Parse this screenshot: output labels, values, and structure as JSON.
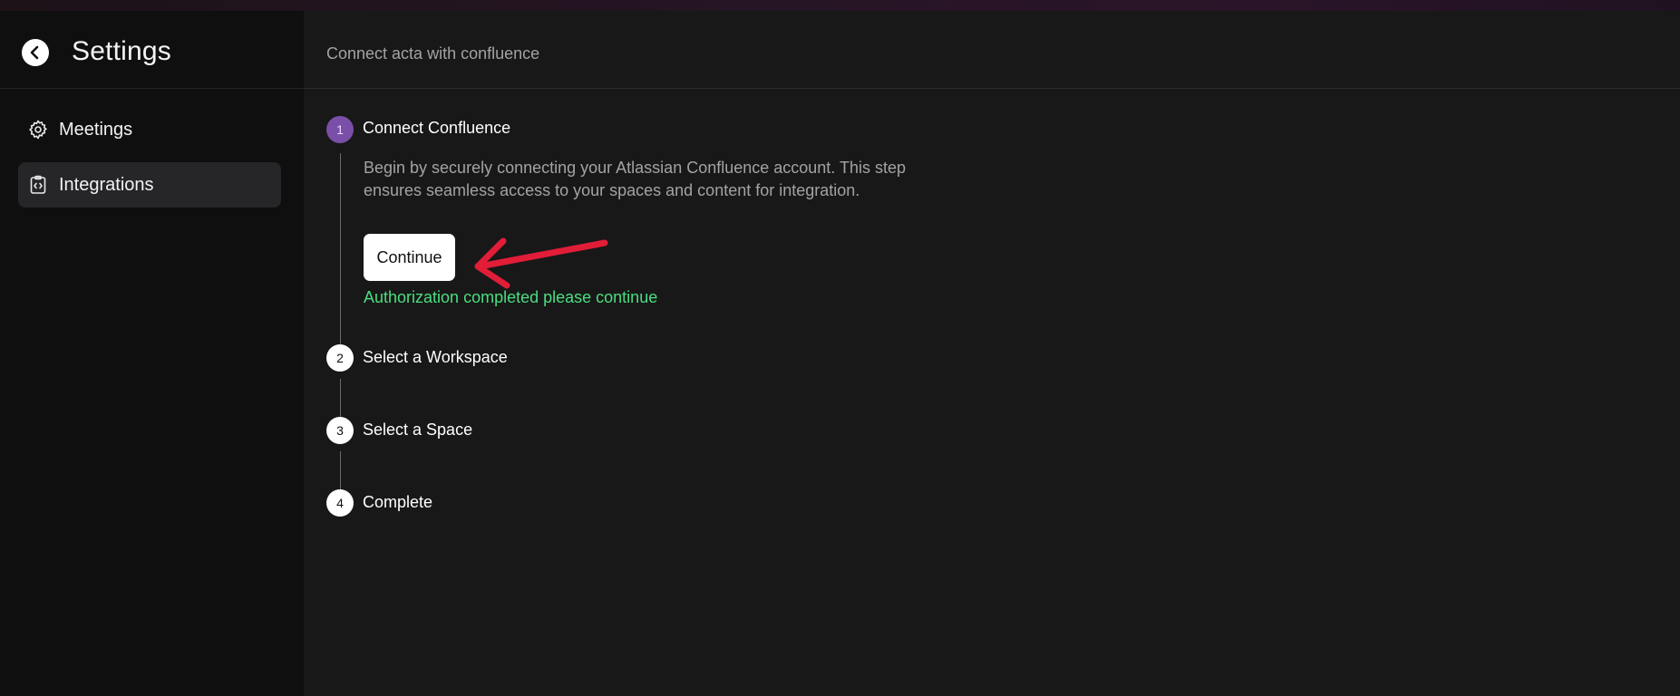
{
  "sidebar": {
    "title": "Settings",
    "back_icon": "chevron-left-icon",
    "items": [
      {
        "label": "Meetings",
        "icon": "gear-icon",
        "active": false
      },
      {
        "label": "Integrations",
        "icon": "clipboard-code-icon",
        "active": true
      }
    ]
  },
  "main": {
    "breadcrumb": "Connect acta with confluence",
    "steps": [
      {
        "number": "1",
        "title": "Connect Confluence",
        "state": "active",
        "description": "Begin by securely connecting your Atlassian Confluence account. This step ensures seamless access to your spaces and content for integration.",
        "button_label": "Continue",
        "status": "Authorization completed please continue"
      },
      {
        "number": "2",
        "title": "Select a Workspace",
        "state": "pending"
      },
      {
        "number": "3",
        "title": "Select a Space",
        "state": "pending"
      },
      {
        "number": "4",
        "title": "Complete",
        "state": "pending"
      }
    ]
  },
  "colors": {
    "accent": "#7a4fa8",
    "success": "#4ade80",
    "annotation_arrow": "#e11d38"
  }
}
